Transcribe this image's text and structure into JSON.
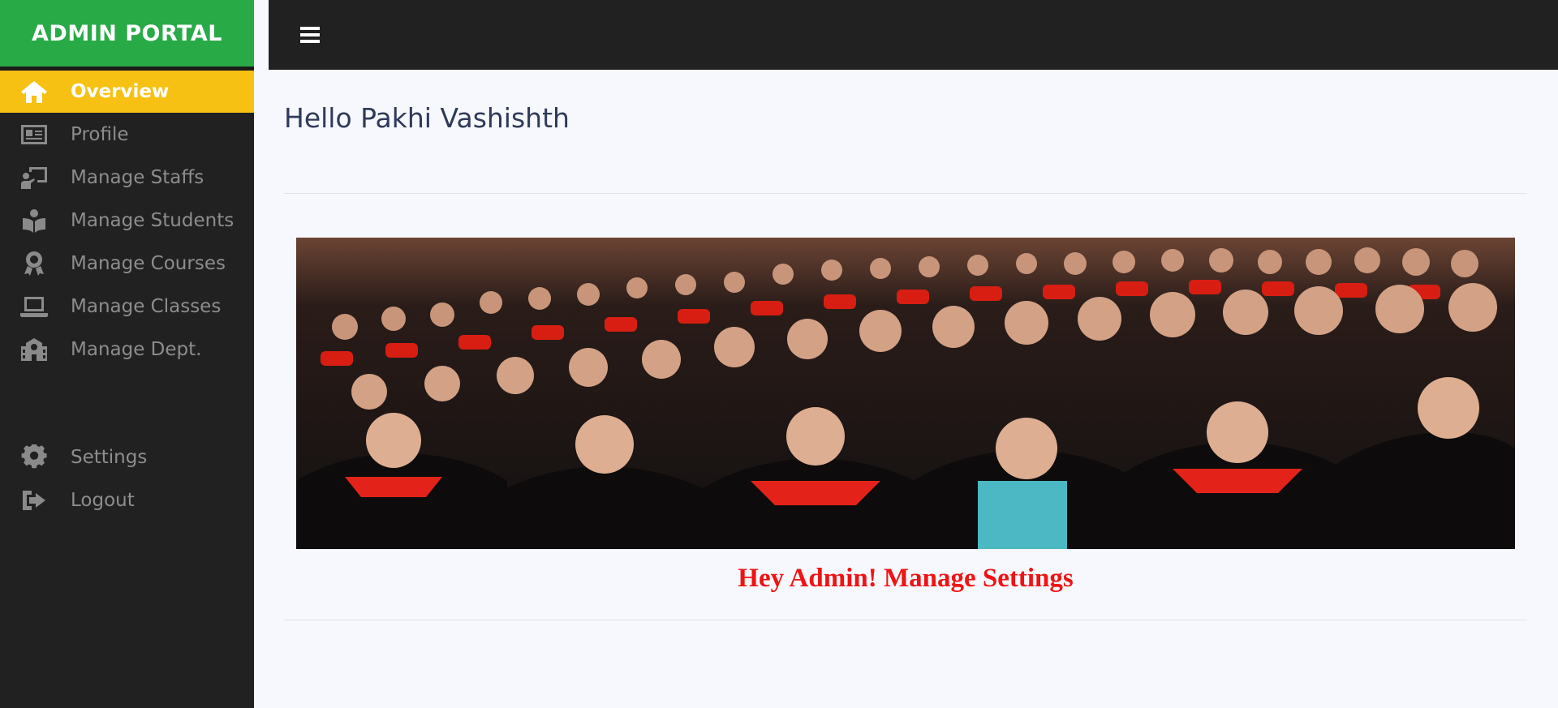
{
  "sidebar": {
    "brand": "ADMIN PORTAL",
    "items": [
      {
        "label": "Overview",
        "icon": "home-icon",
        "active": true
      },
      {
        "label": "Profile",
        "icon": "id-card-icon"
      },
      {
        "label": "Manage Staffs",
        "icon": "chalkboard-teacher-icon"
      },
      {
        "label": "Manage Students",
        "icon": "book-reader-icon"
      },
      {
        "label": "Manage Courses",
        "icon": "award-icon"
      },
      {
        "label": "Manage Classes",
        "icon": "laptop-icon"
      },
      {
        "label": "Manage Dept.",
        "icon": "school-icon"
      }
    ],
    "bottom_items": [
      {
        "label": "Settings",
        "icon": "gear-icon"
      },
      {
        "label": "Logout",
        "icon": "sign-out-icon"
      }
    ]
  },
  "topbar": {
    "menu_icon": "hamburger-icon"
  },
  "main": {
    "greeting": "Hello Pakhi Vashishth",
    "banner_caption": "Hey Admin! Manage Settings"
  },
  "colors": {
    "brand_green": "#28aa47",
    "active_yellow": "#f7c114",
    "sidebar_bg": "#212121",
    "caption_red": "#ef1313"
  }
}
